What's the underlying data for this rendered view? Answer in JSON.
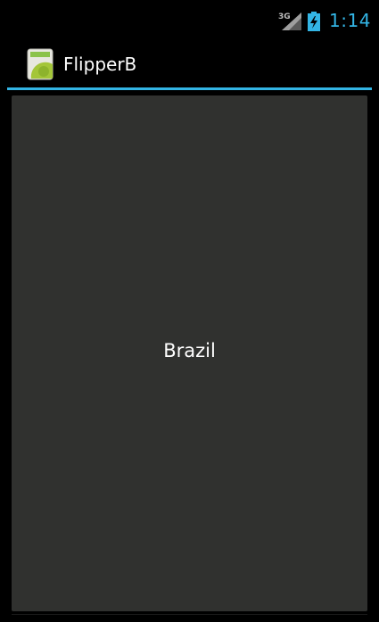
{
  "status_bar": {
    "network_label": "3G",
    "time": "1:14",
    "time_color": "#33b5e5",
    "signal_icon": "signal-strength-icon",
    "battery_icon": "battery-charging-icon"
  },
  "action_bar": {
    "title": "FlipperB",
    "app_icon": "android-app-icon",
    "divider_color": "#33b5e5"
  },
  "content": {
    "flipper_text": "Brazil",
    "panel_color": "#30312f"
  }
}
